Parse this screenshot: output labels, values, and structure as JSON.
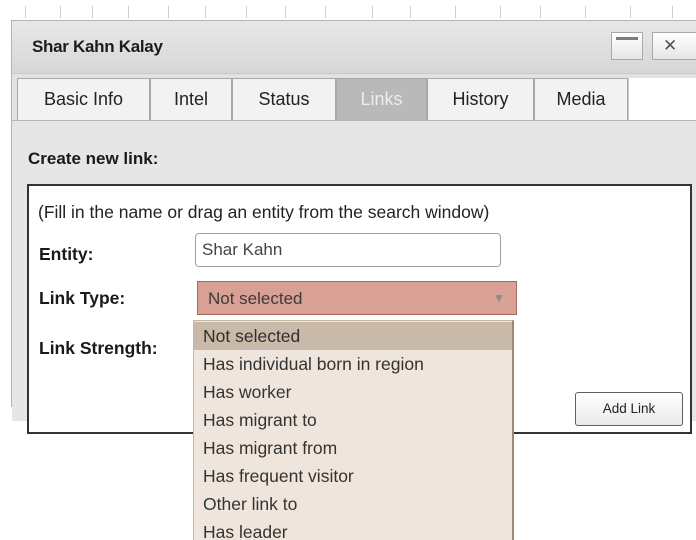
{
  "window": {
    "title": "Shar Kahn Kalay",
    "close_glyph": "✕"
  },
  "tabs": [
    {
      "label": "Basic Info",
      "active": false
    },
    {
      "label": "Intel",
      "active": false
    },
    {
      "label": "Status",
      "active": false
    },
    {
      "label": "Links",
      "active": true
    },
    {
      "label": "History",
      "active": false
    },
    {
      "label": "Media",
      "active": false
    }
  ],
  "form": {
    "section_title": "Create new link:",
    "hint": "(Fill in the name or drag an entity from the search window)",
    "entity_label": "Entity:",
    "entity_value": "Shar Kahn",
    "link_type_label": "Link Type:",
    "link_type_selected": "Not selected",
    "link_strength_label": "Link Strength:",
    "add_link_label": "Add Link"
  },
  "dropdown": {
    "options": [
      "Not selected",
      "Has individual born in region",
      "Has worker",
      "Has migrant to",
      "Has migrant from",
      "Has frequent visitor",
      "Other link to",
      "Has leader"
    ],
    "selected_index": 0
  },
  "colors": {
    "select_bg": "#d9a193",
    "dropdown_bg": "#efe5dc",
    "dropdown_selected_bg": "#c9b9a9",
    "active_tab_bg": "#b9b9b9"
  }
}
